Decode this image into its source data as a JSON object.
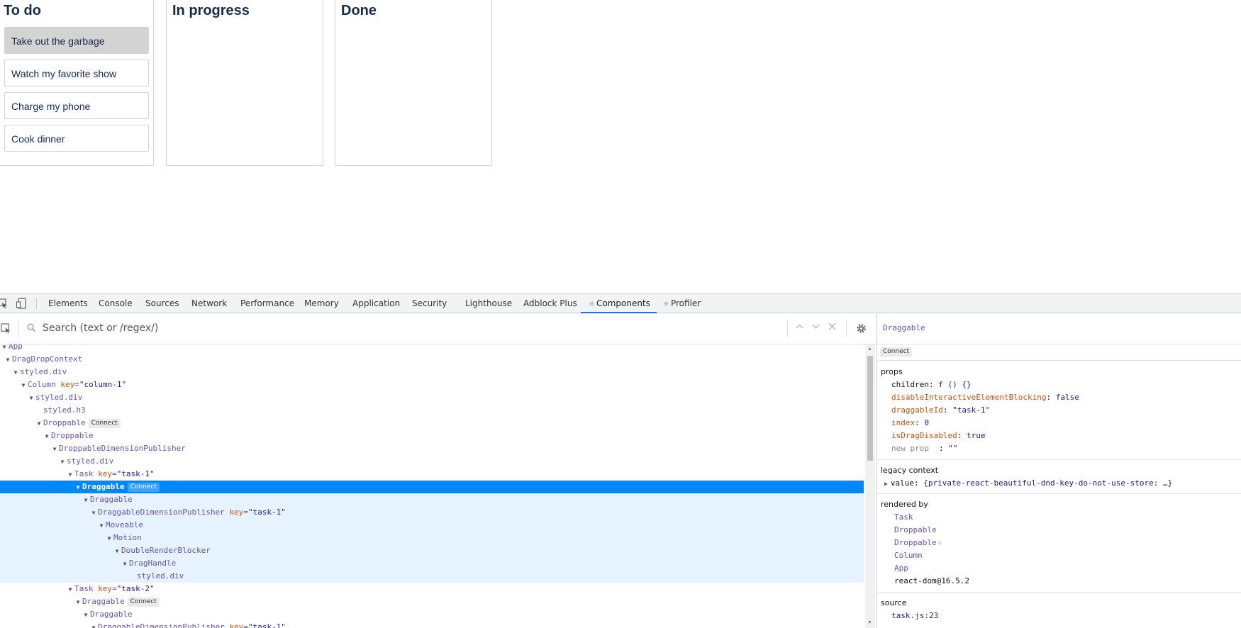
{
  "board": {
    "columns": [
      {
        "title": "To do",
        "tasks": [
          "Take out the garbage",
          "Watch my favorite show",
          "Charge my phone",
          "Cook dinner"
        ]
      },
      {
        "title": "In progress",
        "tasks": []
      },
      {
        "title": "Done",
        "tasks": []
      }
    ]
  },
  "devtools": {
    "tabs": [
      "Elements",
      "Console",
      "Sources",
      "Network",
      "Performance",
      "Memory",
      "Application",
      "Security",
      "Lighthouse",
      "Adblock Plus",
      "Components",
      "Profiler"
    ],
    "active_tab": "Components",
    "search": {
      "placeholder": "Search (text or /regex/)"
    },
    "tree": [
      {
        "name": "App"
      },
      {
        "name": "DragDropContext"
      },
      {
        "name": "styled.div"
      },
      {
        "name": "Column",
        "key": "key",
        "val": "\"column-1\""
      },
      {
        "name": "styled.div"
      },
      {
        "name": "styled.h3"
      },
      {
        "name": "Droppable",
        "badge": "Connect"
      },
      {
        "name": "Droppable"
      },
      {
        "name": "DroppableDimensionPublisher"
      },
      {
        "name": "styled.div"
      },
      {
        "name": "Task",
        "key": "key",
        "val": "\"task-1\""
      },
      {
        "name": "Draggable",
        "badge": "Connect"
      },
      {
        "name": "Draggable"
      },
      {
        "name": "DraggableDimensionPublisher",
        "key": "key",
        "val": "\"task-1\""
      },
      {
        "name": "Moveable"
      },
      {
        "name": "Motion"
      },
      {
        "name": "DoubleRenderBlocker"
      },
      {
        "name": "DragHandle"
      },
      {
        "name": "styled.div"
      },
      {
        "name": "Task",
        "key": "key",
        "val": "\"task-2\""
      },
      {
        "name": "Draggable",
        "badge": "Connect"
      },
      {
        "name": "Draggable"
      },
      {
        "name": "DraggableDimensionPublisher",
        "key": "key",
        "val": "\"task-1\""
      }
    ],
    "inspector": {
      "component": "Draggable",
      "badge": "Connect",
      "props_title": "props",
      "props": [
        {
          "key": "children",
          "value": "f () {}",
          "plain": true
        },
        {
          "key": "disableInteractiveElementBlocking",
          "value": "false"
        },
        {
          "key": "draggableId",
          "value": "\"task-1\""
        },
        {
          "key": "index",
          "value": "0"
        },
        {
          "key": "isDragDisabled",
          "value": "true"
        },
        {
          "key": "new prop",
          "value": ": \"\"",
          "new": true
        }
      ],
      "legacy_title": "legacy context",
      "legacy_value_key": "value",
      "legacy_value": "{private-react-beautiful-dnd-key-do-not-use-store: …}",
      "rendered_title": "rendered by",
      "rendered_by": [
        "Task",
        "Droppable",
        "Droppable",
        "Column",
        "App"
      ],
      "renderer": "react-dom@16.5.2",
      "source_title": "source",
      "source": "task.js:23"
    }
  },
  "colors": {
    "selection": "#0088fa",
    "active_tab_underline": "#1a73e8",
    "component_name": "#6a51b2",
    "prop_key": "#c7540c"
  }
}
